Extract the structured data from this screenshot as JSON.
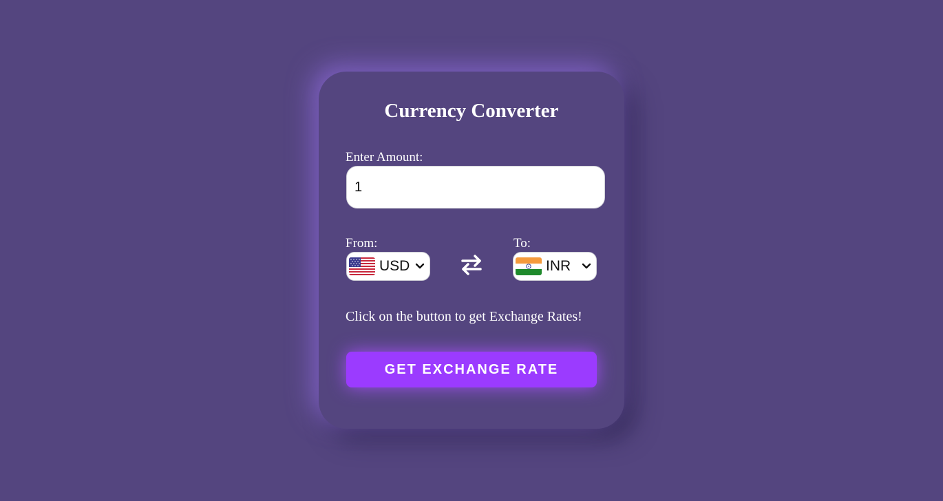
{
  "title": "Currency Converter",
  "amount": {
    "label": "Enter Amount:",
    "value": "1"
  },
  "from": {
    "label": "From:",
    "selected": "USD",
    "flag_icon": "us-flag-icon"
  },
  "to": {
    "label": "To:",
    "selected": "INR",
    "flag_icon": "india-flag-icon"
  },
  "message": "Click on the button to get Exchange Rates!",
  "button": {
    "label": "GET EXCHANGE RATE"
  },
  "colors": {
    "background": "#54457f",
    "accent": "#9b3bff",
    "text": "#ffffff"
  }
}
